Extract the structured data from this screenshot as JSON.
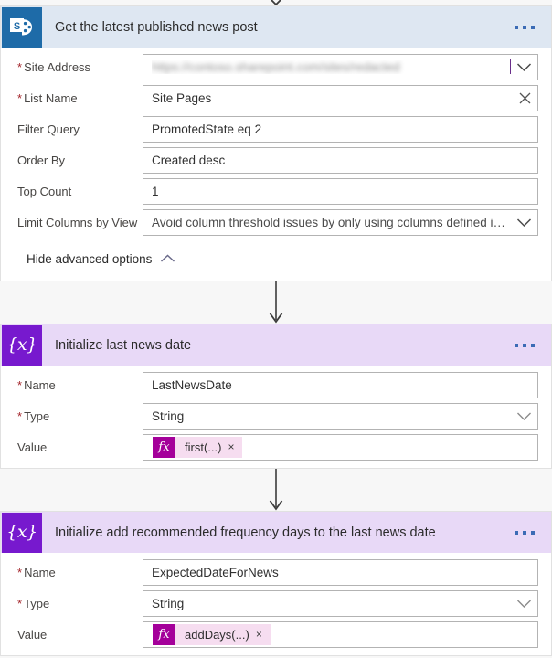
{
  "theme": {
    "page_bg": "#f7f7f7",
    "sharepoint_header_bg": "#dee7f2",
    "sharepoint_icon_bg": "#1e6ba8",
    "variable_header_bg": "#e8d9f7",
    "variable_icon_bg": "#7719ce",
    "required_marker": "#a4262c",
    "token_fx_bg": "#a4009a",
    "token_body_bg": "#f6ddf0",
    "menu_dot": "#3b6bb5"
  },
  "cards": [
    {
      "id": "get-latest-published-news-post",
      "icon": "sharepoint-icon",
      "title": "Get the latest published news post",
      "menu": "more-commands-ellipsis",
      "rows": [
        {
          "label": "Site Address",
          "required": true,
          "control": "combobox",
          "value": "https://contoso.sharepoint.com/sites/redacted",
          "redacted": true,
          "caret": true
        },
        {
          "label": "List Name",
          "required": true,
          "control": "combobox-clearable",
          "value": "Site Pages"
        },
        {
          "label": "Filter Query",
          "required": false,
          "control": "text",
          "value": "PromotedState eq 2"
        },
        {
          "label": "Order By",
          "required": false,
          "control": "text",
          "value": "Created desc"
        },
        {
          "label": "Top Count",
          "required": false,
          "control": "text",
          "value": "1"
        },
        {
          "label": "Limit Columns by View",
          "required": false,
          "control": "dropdown",
          "value": "Avoid column threshold issues by only using columns defined in a view"
        }
      ],
      "advanced_options_label": "Hide advanced options",
      "advanced_options_state": "expanded"
    },
    {
      "id": "initialize-last-news-date",
      "icon": "variable-icon",
      "title": "Initialize last news date",
      "menu": "more-commands-ellipsis",
      "rows": [
        {
          "label": "Name",
          "required": true,
          "control": "text",
          "value": "LastNewsDate"
        },
        {
          "label": "Type",
          "required": true,
          "control": "dropdown",
          "value": "String"
        },
        {
          "label": "Value",
          "required": false,
          "control": "token",
          "token_label": "first(...)",
          "token_icon": "fx",
          "token_remove": "×"
        }
      ]
    },
    {
      "id": "initialize-expected-date-for-news",
      "icon": "variable-icon",
      "title": "Initialize add recommended frequency days to the last news date",
      "menu": "more-commands-ellipsis",
      "rows": [
        {
          "label": "Name",
          "required": true,
          "control": "text",
          "value": "ExpectedDateForNews"
        },
        {
          "label": "Type",
          "required": true,
          "control": "dropdown",
          "value": "String"
        },
        {
          "label": "Value",
          "required": false,
          "control": "token",
          "token_label": "addDays(...)",
          "token_icon": "fx",
          "token_remove": "×"
        }
      ]
    }
  ],
  "glyphs": {
    "variable_icon_text": "{x}",
    "clear_x": "✕",
    "required_star": "*"
  }
}
